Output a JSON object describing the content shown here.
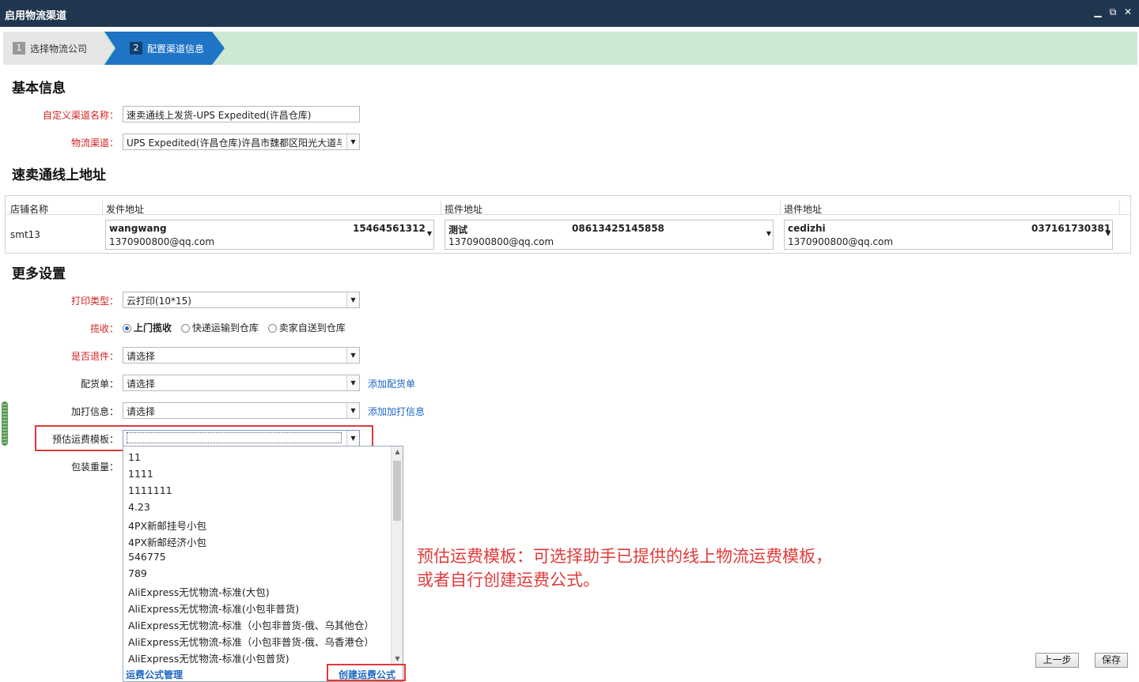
{
  "window": {
    "title": "启用物流渠道",
    "restore_glyph": "⧉",
    "close_glyph": "✕"
  },
  "steps": [
    {
      "num": "1",
      "label": "选择物流公司"
    },
    {
      "num": "2",
      "label": "配置渠道信息"
    }
  ],
  "basic": {
    "heading": "基本信息",
    "channel_name_label": "自定义渠道名称：",
    "channel_name_value": "速卖通线上发货-UPS Expedited(许昌仓库)",
    "logistics_label": "物流渠道：",
    "logistics_value": "UPS Expedited(许昌仓库)许昌市魏都区阳光大道与建"
  },
  "address": {
    "heading": "速卖通线上地址",
    "headers": [
      "店铺名称",
      "发件地址",
      "揽件地址",
      "退件地址"
    ],
    "store": "smt13",
    "sender": {
      "name": "wangwang",
      "phone": "15464561312",
      "email": "1370900800@qq.com"
    },
    "pickup": {
      "name": "测试",
      "phone": "08613425145858",
      "email": "1370900800@qq.com"
    },
    "return": {
      "name": "cedizhi",
      "phone": "037161730381",
      "email": "1370900800@qq.com"
    }
  },
  "more": {
    "heading": "更多设置",
    "print_type_label": "打印类型：",
    "print_type_value": "云打印(10*15)",
    "pickup_label": "揽收：",
    "pickup_options": [
      "上门揽收",
      "快递运输到仓库",
      "卖家自送到仓库"
    ],
    "pickup_selected": "上门揽收",
    "return_label": "是否退件：",
    "return_value": "请选择",
    "packing_label": "配货单：",
    "packing_value": "请选择",
    "packing_link": "添加配货单",
    "extra_label": "加打信息：",
    "extra_value": "请选择",
    "extra_link": "添加加打信息",
    "freight_label": "预估运费模板：",
    "freight_value": "",
    "weight_label": "包装重量："
  },
  "dropdown": {
    "options": [
      "11",
      "1111",
      "1111111",
      "4.23",
      "4PX新邮挂号小包",
      "4PX新邮经济小包",
      "546775",
      "789",
      "AliExpress无忧物流-标准(大包)",
      "AliExpress无忧物流-标准(小包非普货)",
      "AliExpress无忧物流-标准（小包非普货-俄、乌其他仓）",
      "AliExpress无忧物流-标准（小包非普货-俄、乌香港仓）",
      "AliExpress无忧物流-标准(小包普货)"
    ],
    "manage_link": "运费公式管理",
    "create_link": "创建运费公式"
  },
  "annotation": {
    "line1": "预估运费模板：可选择助手已提供的线上物流运费模板，",
    "line2": "或者自行创建运费公式。"
  },
  "buttons": {
    "prev": "上一步",
    "save": "保存"
  }
}
